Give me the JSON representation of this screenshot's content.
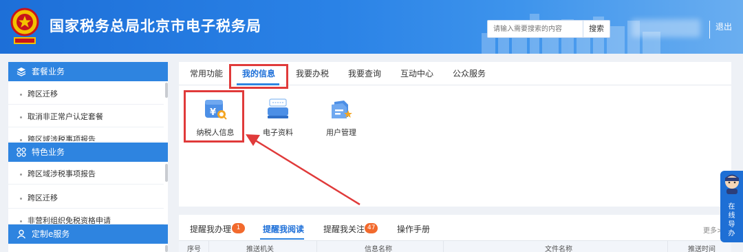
{
  "header": {
    "title": "国家税务总局北京市电子税务局",
    "search_placeholder": "请输入需要搜索的内容",
    "search_button": "搜索",
    "logout": "退出",
    "brand_color": "#2a82e6"
  },
  "sidebar": {
    "sections": [
      {
        "label": "套餐业务",
        "icon": "layers-icon",
        "items": [
          "跨区迁移",
          "取消非正常户认定套餐",
          "跨区域涉税事项报告"
        ]
      },
      {
        "label": "特色业务",
        "icon": "grid-icon",
        "items": [
          "跨区域涉税事项报告",
          "跨区迁移",
          "非营利组织免税资格申请"
        ]
      },
      {
        "label": "定制e服务",
        "icon": "user-icon",
        "items": []
      }
    ]
  },
  "main": {
    "tabs": [
      "常用功能",
      "我的信息",
      "我要办税",
      "我要查询",
      "互动中心",
      "公众服务"
    ],
    "active_tab": "我的信息",
    "functions": [
      {
        "label": "纳税人信息",
        "icon": "taxpayer-info-icon"
      },
      {
        "label": "电子资料",
        "icon": "e-documents-icon"
      },
      {
        "label": "用户管理",
        "icon": "user-management-icon"
      }
    ]
  },
  "reminders": {
    "tabs": [
      {
        "label": "提醒我办理",
        "badge": "1"
      },
      {
        "label": "提醒我阅读",
        "badge": ""
      },
      {
        "label": "提醒我关注",
        "badge": "47"
      },
      {
        "label": "操作手册",
        "badge": ""
      }
    ],
    "active_tab": "提醒我阅读",
    "more": "更多>",
    "columns": [
      "序号",
      "推送机关",
      "信息名称",
      "文件名称",
      "推送时间"
    ]
  },
  "float_widget": {
    "text": [
      "在",
      "线",
      "导",
      "办"
    ]
  },
  "annotation_color": "#e03a3a"
}
